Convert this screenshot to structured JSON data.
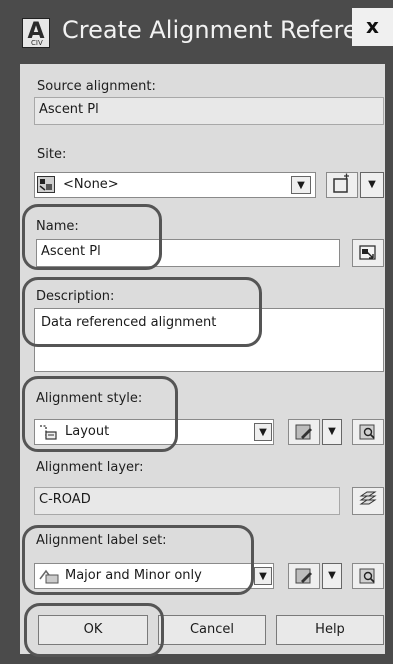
{
  "window": {
    "title": "Create Alignment Reference",
    "app_icon": "A",
    "app_icon_sub": "CIV",
    "close": "x"
  },
  "source_alignment": {
    "label": "Source alignment:",
    "value": "Ascent Pl"
  },
  "site": {
    "label": "Site:",
    "value": "<None>"
  },
  "name": {
    "label": "Name:",
    "value": "Ascent Pl"
  },
  "description": {
    "label": "Description:",
    "value": "Data referenced alignment"
  },
  "alignment_style": {
    "label": "Alignment style:",
    "value": "Layout"
  },
  "alignment_layer": {
    "label": "Alignment layer:",
    "value": "C-ROAD"
  },
  "alignment_label_set": {
    "label": "Alignment label set:",
    "value": "Major and Minor only"
  },
  "buttons": {
    "ok": "OK",
    "cancel": "Cancel",
    "help": "Help"
  },
  "icons": {
    "dropdown_arrow": "▼",
    "site_icon": "site-icon",
    "name_pick_icon": "name-template-icon",
    "style_edit_icon": "edit-style-icon",
    "style_view_icon": "view-style-icon",
    "layer_icon": "layer-stack-icon"
  },
  "colors": {
    "title_bar": "#4b4b4b",
    "dialog_bg": "#dcdcdc",
    "highlight_ring": "#555555"
  }
}
